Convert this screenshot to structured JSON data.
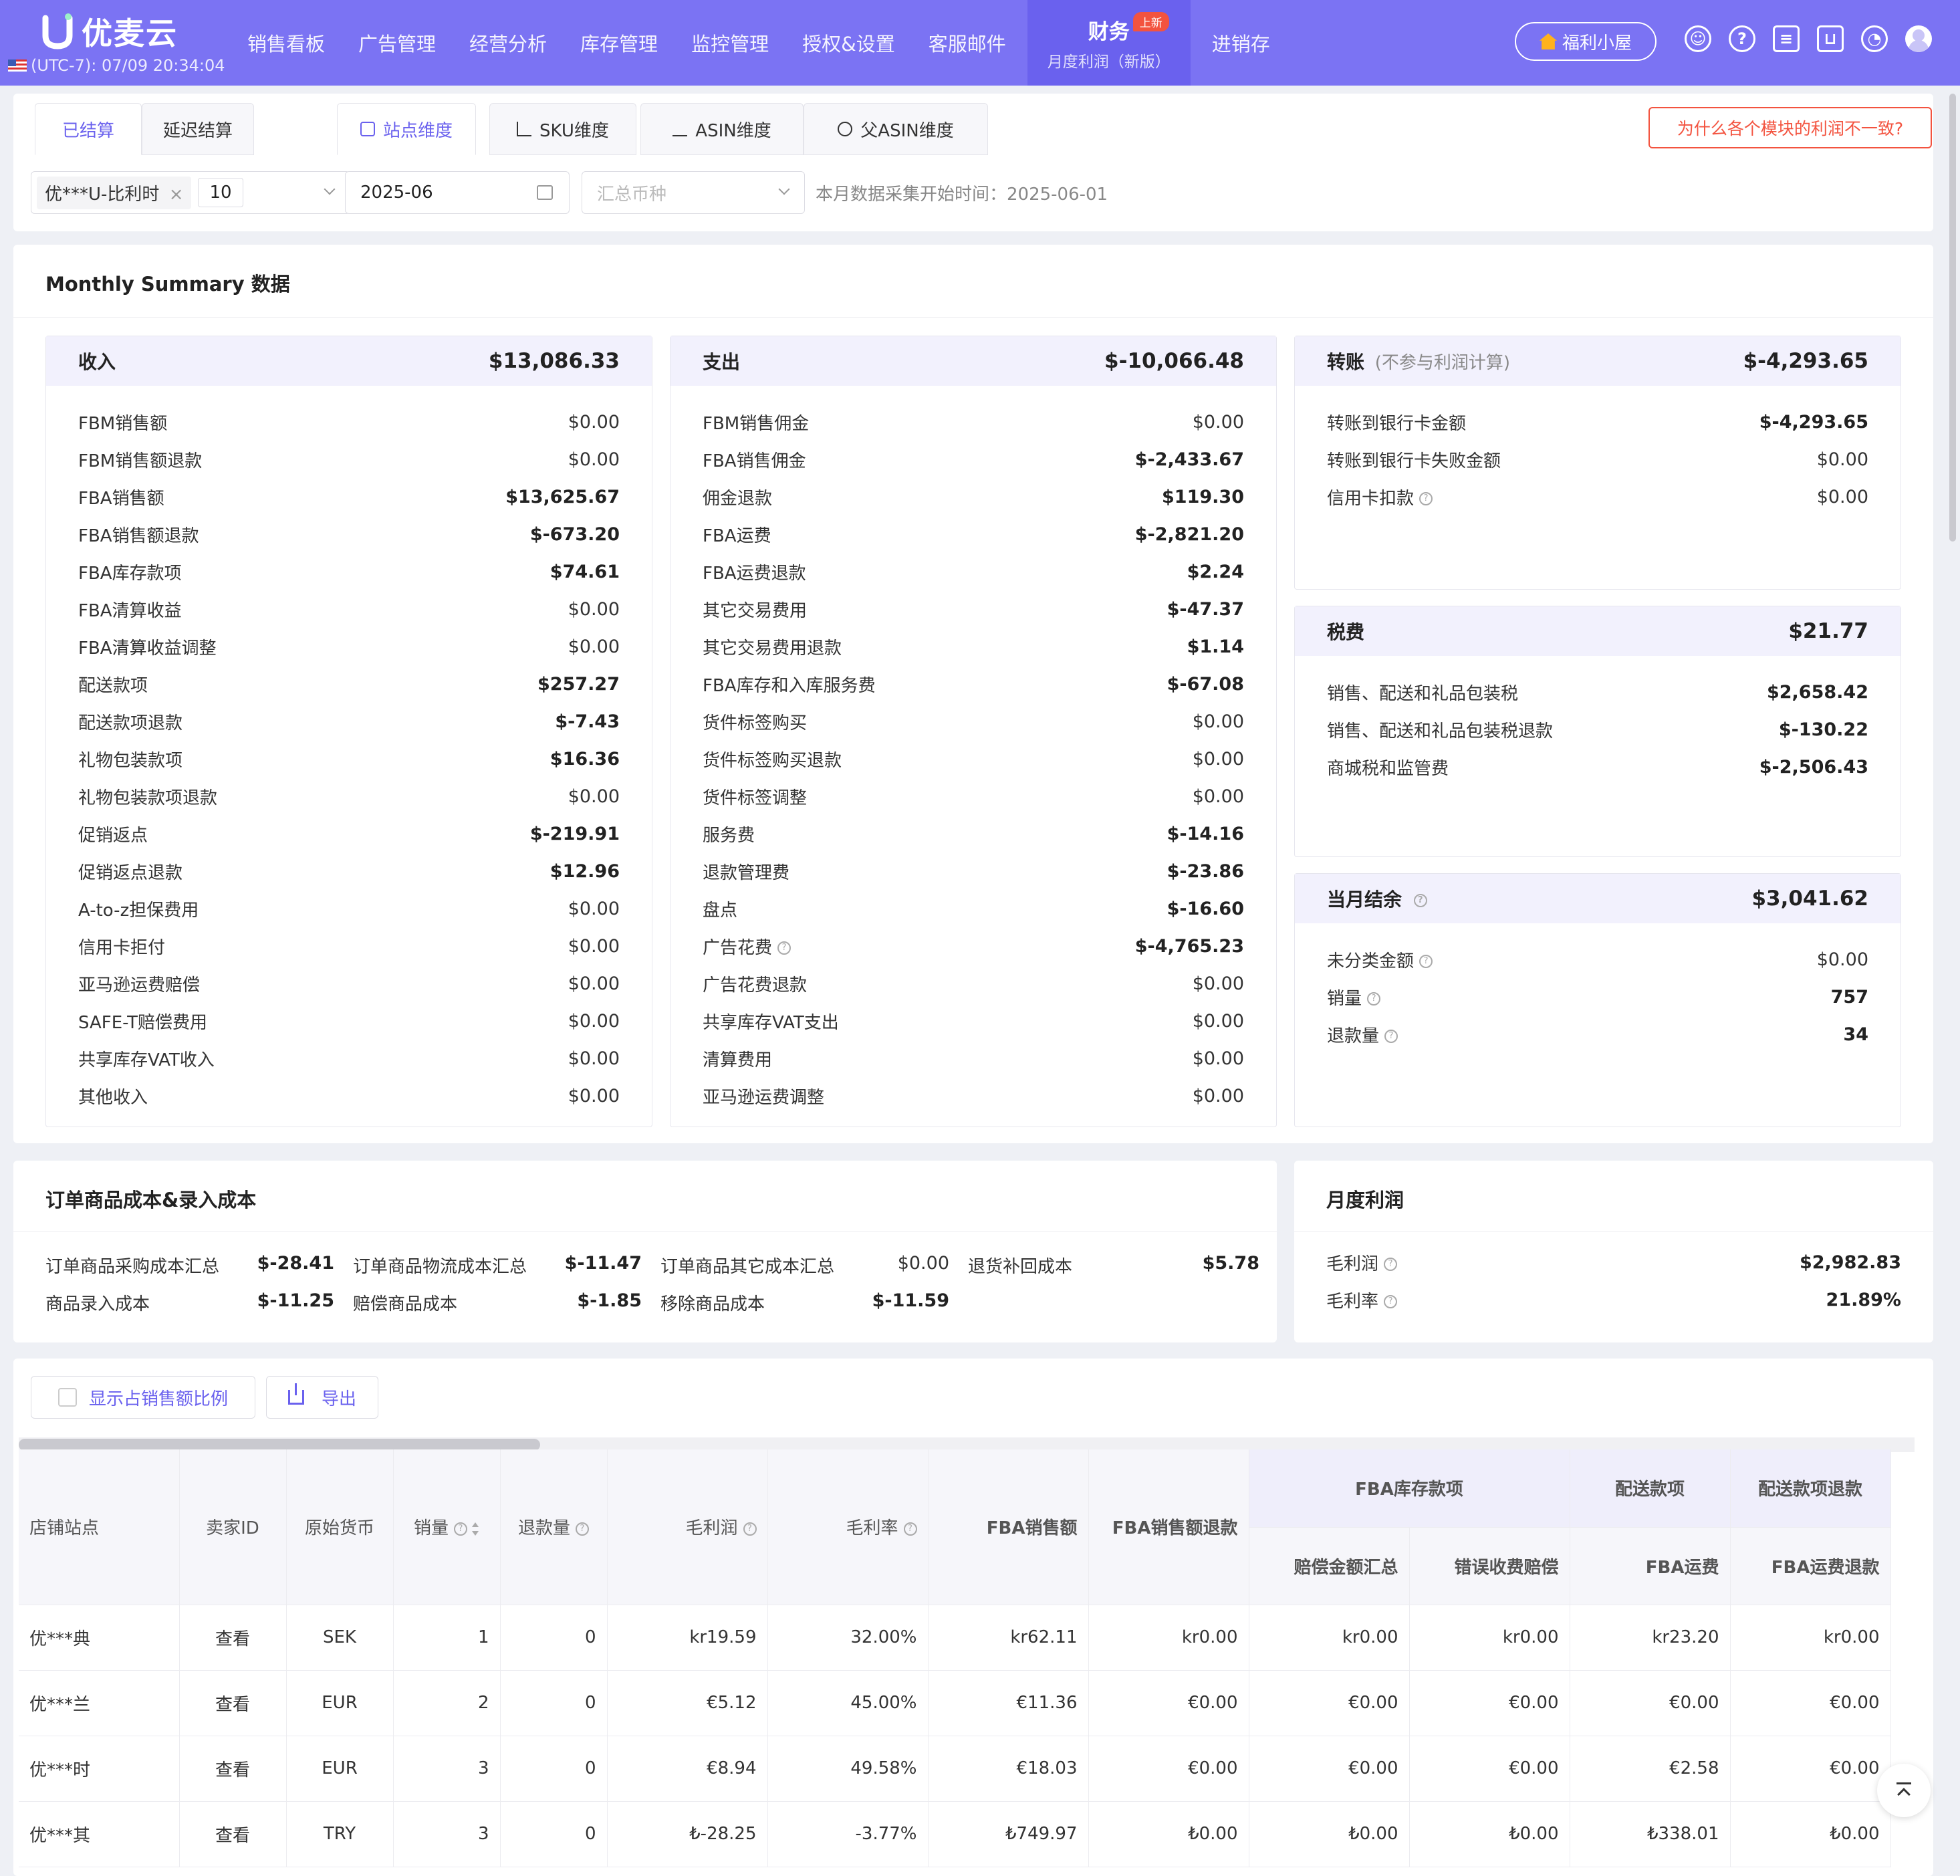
{
  "app": {
    "logo_text": "优麦云",
    "timezone": "(UTC-7): 07/09 20:34:04"
  },
  "nav": {
    "items": [
      "销售看板",
      "广告管理",
      "经营分析",
      "库存管理",
      "监控管理",
      "授权&设置",
      "客服邮件"
    ],
    "active_main": "财务",
    "active_sub": "月度利润（新版）",
    "badge": "上新",
    "last": "进销存",
    "welfare": "福利小屋"
  },
  "tabs": {
    "settle": [
      "已结算",
      "延迟结算"
    ],
    "dims": [
      "站点维度",
      "SKU维度",
      "ASIN维度",
      "父ASIN维度"
    ],
    "why": "为什么各个模块的利润不一致?"
  },
  "filters": {
    "shop_chip": "优***U-比利时",
    "shop_count": "10",
    "month": "2025-06",
    "currency_placeholder": "汇总币种",
    "note": "本月数据采集开始时间：2025-06-01"
  },
  "summary": {
    "title": "Monthly Summary 数据",
    "income": {
      "title": "收入",
      "total": "$13,086.33",
      "rows": [
        {
          "label": "FBM销售额",
          "value": "$0.00"
        },
        {
          "label": "FBM销售额退款",
          "value": "$0.00"
        },
        {
          "label": "FBA销售额",
          "value": "$13,625.67"
        },
        {
          "label": "FBA销售额退款",
          "value": "$-673.20"
        },
        {
          "label": "FBA库存款项",
          "value": "$74.61"
        },
        {
          "label": "FBA清算收益",
          "value": "$0.00"
        },
        {
          "label": "FBA清算收益调整",
          "value": "$0.00"
        },
        {
          "label": "配送款项",
          "value": "$257.27"
        },
        {
          "label": "配送款项退款",
          "value": "$-7.43"
        },
        {
          "label": "礼物包装款项",
          "value": "$16.36"
        },
        {
          "label": "礼物包装款项退款",
          "value": "$0.00"
        },
        {
          "label": "促销返点",
          "value": "$-219.91"
        },
        {
          "label": "促销返点退款",
          "value": "$12.96"
        },
        {
          "label": "A-to-z担保费用",
          "value": "$0.00"
        },
        {
          "label": "信用卡拒付",
          "value": "$0.00"
        },
        {
          "label": "亚马逊运费赔偿",
          "value": "$0.00"
        },
        {
          "label": "SAFE-T赔偿费用",
          "value": "$0.00"
        },
        {
          "label": "共享库存VAT收入",
          "value": "$0.00"
        },
        {
          "label": "其他收入",
          "value": "$0.00"
        }
      ]
    },
    "expense": {
      "title": "支出",
      "total": "$-10,066.48",
      "rows": [
        {
          "label": "FBM销售佣金",
          "value": "$0.00"
        },
        {
          "label": "FBA销售佣金",
          "value": "$-2,433.67"
        },
        {
          "label": "佣金退款",
          "value": "$119.30"
        },
        {
          "label": "FBA运费",
          "value": "$-2,821.20"
        },
        {
          "label": "FBA运费退款",
          "value": "$2.24"
        },
        {
          "label": "其它交易费用",
          "value": "$-47.37"
        },
        {
          "label": "其它交易费用退款",
          "value": "$1.14"
        },
        {
          "label": "FBA库存和入库服务费",
          "value": "$-67.08"
        },
        {
          "label": "货件标签购买",
          "value": "$0.00"
        },
        {
          "label": "货件标签购买退款",
          "value": "$0.00"
        },
        {
          "label": "货件标签调整",
          "value": "$0.00"
        },
        {
          "label": "服务费",
          "value": "$-14.16"
        },
        {
          "label": "退款管理费",
          "value": "$-23.86"
        },
        {
          "label": "盘点",
          "value": "$-16.60"
        },
        {
          "label": "广告花费",
          "value": "$-4,765.23"
        },
        {
          "label": "广告花费退款",
          "value": "$0.00"
        },
        {
          "label": "共享库存VAT支出",
          "value": "$0.00"
        },
        {
          "label": "清算费用",
          "value": "$0.00"
        },
        {
          "label": "亚马逊运费调整",
          "value": "$0.00"
        }
      ]
    },
    "transfer": {
      "title": "转账",
      "sub": "(不参与利润计算)",
      "total": "$-4,293.65",
      "rows": [
        {
          "label": "转账到银行卡金额",
          "value": "$-4,293.65"
        },
        {
          "label": "转账到银行卡失败金额",
          "value": "$0.00"
        },
        {
          "label": "信用卡扣款",
          "value": "$0.00"
        }
      ]
    },
    "tax": {
      "title": "税费",
      "total": "$21.77",
      "rows": [
        {
          "label": "销售、配送和礼品包装税",
          "value": "$2,658.42"
        },
        {
          "label": "销售、配送和礼品包装税退款",
          "value": "$-130.22"
        },
        {
          "label": "商城税和监管费",
          "value": "$-2,506.43"
        }
      ]
    },
    "balance": {
      "title": "当月结余",
      "total": "$3,041.62",
      "rows": [
        {
          "label": "未分类金额",
          "value": "$0.00"
        },
        {
          "label": "销量",
          "value": "757"
        },
        {
          "label": "退款量",
          "value": "34"
        }
      ]
    }
  },
  "cost": {
    "title": "订单商品成本&录入成本",
    "items": [
      {
        "label": "订单商品采购成本汇总",
        "value": "$-28.41"
      },
      {
        "label": "订单商品物流成本汇总",
        "value": "$-11.47"
      },
      {
        "label": "订单商品其它成本汇总",
        "value": "$0.00"
      },
      {
        "label": "退货补回成本",
        "value": "$5.78"
      },
      {
        "label": "商品录入成本",
        "value": "$-11.25"
      },
      {
        "label": "赔偿商品成本",
        "value": "$-1.85"
      },
      {
        "label": "移除商品成本",
        "value": "$-11.59"
      }
    ]
  },
  "profit": {
    "title": "月度利润",
    "gross_profit_label": "毛利润",
    "gross_profit": "$2,982.83",
    "gross_margin_label": "毛利率",
    "gross_margin": "21.89%"
  },
  "table": {
    "show_ratio": "显示占销售额比例",
    "export": "导出",
    "groups": {
      "fba_inventory": "FBA库存款项",
      "delivery": "配送款项",
      "delivery_refund": "配送款项退款"
    },
    "headers": {
      "shop": "店铺站点",
      "seller": "卖家ID",
      "currency": "原始货币",
      "sales": "销量",
      "refunds": "退款量",
      "gross_profit": "毛利润",
      "gross_margin": "毛利率",
      "fba_sales": "FBA销售额",
      "fba_sales_refund": "FBA销售额退款",
      "comp_total": "赔偿金额汇总",
      "fee_comp": "错误收费赔偿",
      "fba_shipping": "FBA运费",
      "fba_shipping_refund": "FBA运费退款"
    },
    "rows": [
      {
        "shop": "优***典",
        "seller": "查看",
        "currency": "SEK",
        "sales": "1",
        "refunds": "0",
        "gp": "kr19.59",
        "gm": "32.00%",
        "fba_sales": "kr62.11",
        "fba_refund": "kr0.00",
        "comp": "kr0.00",
        "fee": "kr0.00",
        "ship": "kr23.20",
        "ship_refund": "kr0.00"
      },
      {
        "shop": "优***兰",
        "seller": "查看",
        "currency": "EUR",
        "sales": "2",
        "refunds": "0",
        "gp": "€5.12",
        "gm": "45.00%",
        "fba_sales": "€11.36",
        "fba_refund": "€0.00",
        "comp": "€0.00",
        "fee": "€0.00",
        "ship": "€0.00",
        "ship_refund": "€0.00"
      },
      {
        "shop": "优***时",
        "seller": "查看",
        "currency": "EUR",
        "sales": "3",
        "refunds": "0",
        "gp": "€8.94",
        "gm": "49.58%",
        "fba_sales": "€18.03",
        "fba_refund": "€0.00",
        "comp": "€0.00",
        "fee": "€0.00",
        "ship": "€2.58",
        "ship_refund": "€0.00"
      },
      {
        "shop": "优***其",
        "seller": "查看",
        "currency": "TRY",
        "sales": "3",
        "refunds": "0",
        "gp": "₺-28.25",
        "gm": "-3.77%",
        "fba_sales": "₺749.97",
        "fba_refund": "₺0.00",
        "comp": "₺0.00",
        "fee": "₺0.00",
        "ship": "₺338.01",
        "ship_refund": "₺0.00"
      }
    ]
  }
}
